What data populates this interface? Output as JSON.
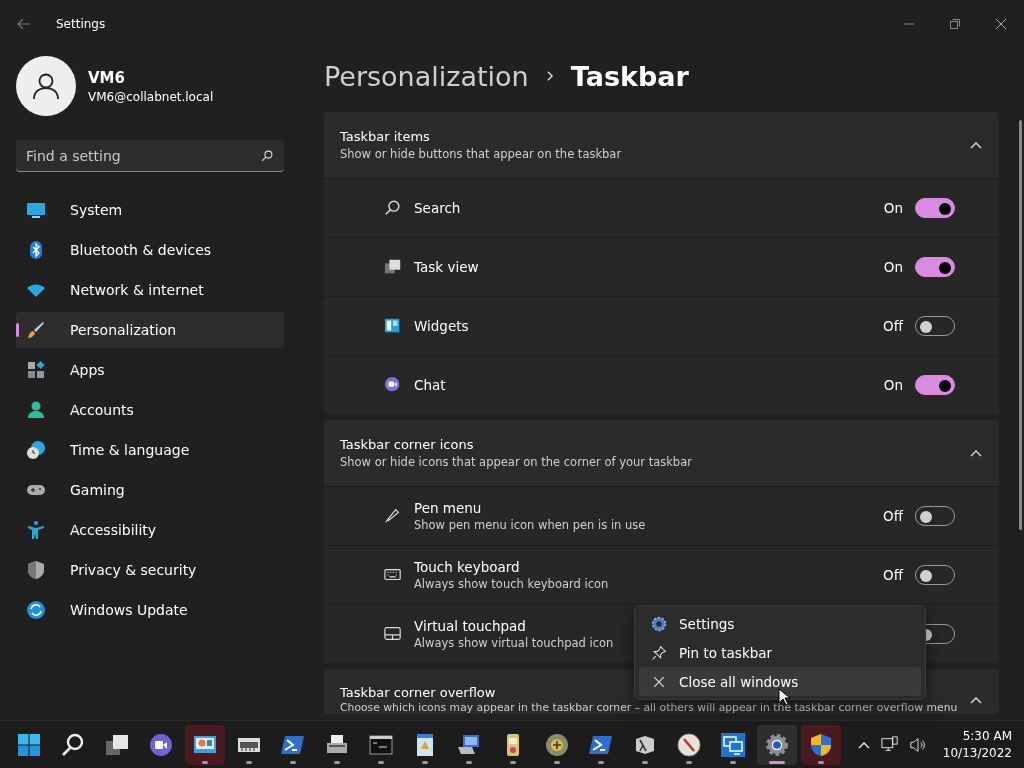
{
  "window": {
    "title": "Settings"
  },
  "user": {
    "name": "VM6",
    "email": "VM6@collabnet.local"
  },
  "search": {
    "placeholder": "Find a setting"
  },
  "nav": [
    {
      "label": "System",
      "kind": "system",
      "selected": false
    },
    {
      "label": "Bluetooth & devices",
      "kind": "bluetooth",
      "selected": false
    },
    {
      "label": "Network & internet",
      "kind": "network",
      "selected": false
    },
    {
      "label": "Personalization",
      "kind": "brush",
      "selected": true
    },
    {
      "label": "Apps",
      "kind": "apps",
      "selected": false
    },
    {
      "label": "Accounts",
      "kind": "accounts",
      "selected": false
    },
    {
      "label": "Time & language",
      "kind": "time",
      "selected": false
    },
    {
      "label": "Gaming",
      "kind": "gaming",
      "selected": false
    },
    {
      "label": "Accessibility",
      "kind": "accessibility",
      "selected": false
    },
    {
      "label": "Privacy & security",
      "kind": "shield",
      "selected": false
    },
    {
      "label": "Windows Update",
      "kind": "update",
      "selected": false
    }
  ],
  "breadcrumb": {
    "parent": "Personalization",
    "current": "Taskbar"
  },
  "sections": [
    {
      "title": "Taskbar items",
      "description": "Show or hide buttons that appear on the taskbar",
      "expanded": true,
      "rows": [
        {
          "label": "Search",
          "kind": "search",
          "state": "On",
          "on": true
        },
        {
          "label": "Task view",
          "kind": "taskview",
          "state": "On",
          "on": true
        },
        {
          "label": "Widgets",
          "kind": "widgets",
          "state": "Off",
          "on": false
        },
        {
          "label": "Chat",
          "kind": "chat",
          "state": "On",
          "on": true
        }
      ]
    },
    {
      "title": "Taskbar corner icons",
      "description": "Show or hide icons that appear on the corner of your taskbar",
      "expanded": true,
      "rows": [
        {
          "label": "Pen menu",
          "description": "Show pen menu icon when pen is in use",
          "kind": "pen",
          "state": "Off",
          "on": false
        },
        {
          "label": "Touch keyboard",
          "description": "Always show touch keyboard icon",
          "kind": "keyboard",
          "state": "Off",
          "on": false
        },
        {
          "label": "Virtual touchpad",
          "description": "Always show virtual touchpad icon",
          "kind": "touchpad",
          "on": false
        }
      ]
    },
    {
      "title": "Taskbar corner overflow",
      "description": "Choose which icons may appear in the taskbar corner – all others will appear in the taskbar corner overflow menu",
      "expanded": true
    }
  ],
  "context_menu": [
    {
      "label": "Settings",
      "kind": "gear",
      "selected": false
    },
    {
      "label": "Pin to taskbar",
      "kind": "pin",
      "selected": false
    },
    {
      "label": "Close all windows",
      "kind": "close",
      "selected": true
    }
  ],
  "taskbar": {
    "items": [
      {
        "kind": "windows",
        "running": false,
        "selected": false,
        "alert": false
      },
      {
        "kind": "search",
        "running": false,
        "selected": false,
        "alert": false
      },
      {
        "kind": "taskview",
        "running": false,
        "selected": false,
        "alert": false
      },
      {
        "kind": "chat",
        "running": false,
        "selected": false,
        "alert": false
      },
      {
        "kind": "monitor",
        "running": true,
        "selected": false,
        "alert": true
      },
      {
        "kind": "server",
        "running": true,
        "selected": false,
        "alert": false
      },
      {
        "kind": "powershell",
        "running": true,
        "selected": false,
        "alert": false
      },
      {
        "kind": "printer",
        "running": true,
        "selected": false,
        "alert": false
      },
      {
        "kind": "terminal",
        "running": true,
        "selected": false,
        "alert": false
      },
      {
        "kind": "document",
        "running": true,
        "selected": false,
        "alert": false
      },
      {
        "kind": "network",
        "running": true,
        "selected": false,
        "alert": false
      },
      {
        "kind": "package",
        "running": true,
        "selected": false,
        "alert": false
      },
      {
        "kind": "disc",
        "running": true,
        "selected": false,
        "alert": false
      },
      {
        "kind": "powershell",
        "running": true,
        "selected": false,
        "alert": false
      },
      {
        "kind": "lambda",
        "running": true,
        "selected": false,
        "alert": false
      },
      {
        "kind": "compass",
        "running": true,
        "selected": false,
        "alert": false
      },
      {
        "kind": "remote",
        "running": true,
        "selected": false,
        "alert": false
      },
      {
        "kind": "gear",
        "running": true,
        "selected": true,
        "alert": false
      },
      {
        "kind": "shield",
        "running": true,
        "selected": false,
        "alert": true
      }
    ],
    "time": "5:30 AM",
    "date": "10/13/2022"
  }
}
